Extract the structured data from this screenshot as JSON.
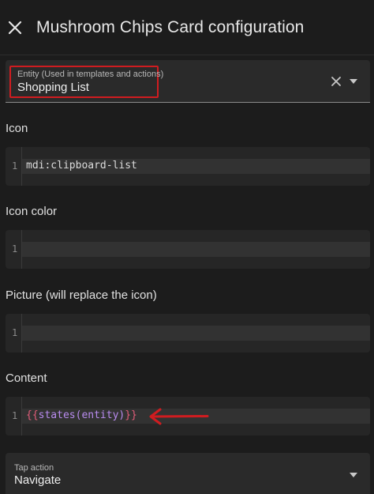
{
  "dialog": {
    "title": "Mushroom Chips Card configuration"
  },
  "entity": {
    "label": "Entity (Used in templates and actions)",
    "value": "Shopping List"
  },
  "icon": {
    "label": "Icon",
    "line_number": "1",
    "value": "mdi:clipboard-list"
  },
  "icon_color": {
    "label": "Icon color",
    "line_number": "1",
    "value": ""
  },
  "picture": {
    "label": "Picture (will replace the icon)",
    "line_number": "1",
    "value": ""
  },
  "content": {
    "label": "Content",
    "line_number": "1",
    "open_braces": "{{",
    "expression": "states(entity)",
    "close_braces": "}}"
  },
  "tap_action": {
    "label": "Tap action",
    "value": "Navigate"
  },
  "colors": {
    "background": "#1c1c1c",
    "highlight_box": "#d01c20",
    "arrow": "#d01c20",
    "template_brace": "#e35d7a",
    "template_function": "#b98cf0"
  }
}
